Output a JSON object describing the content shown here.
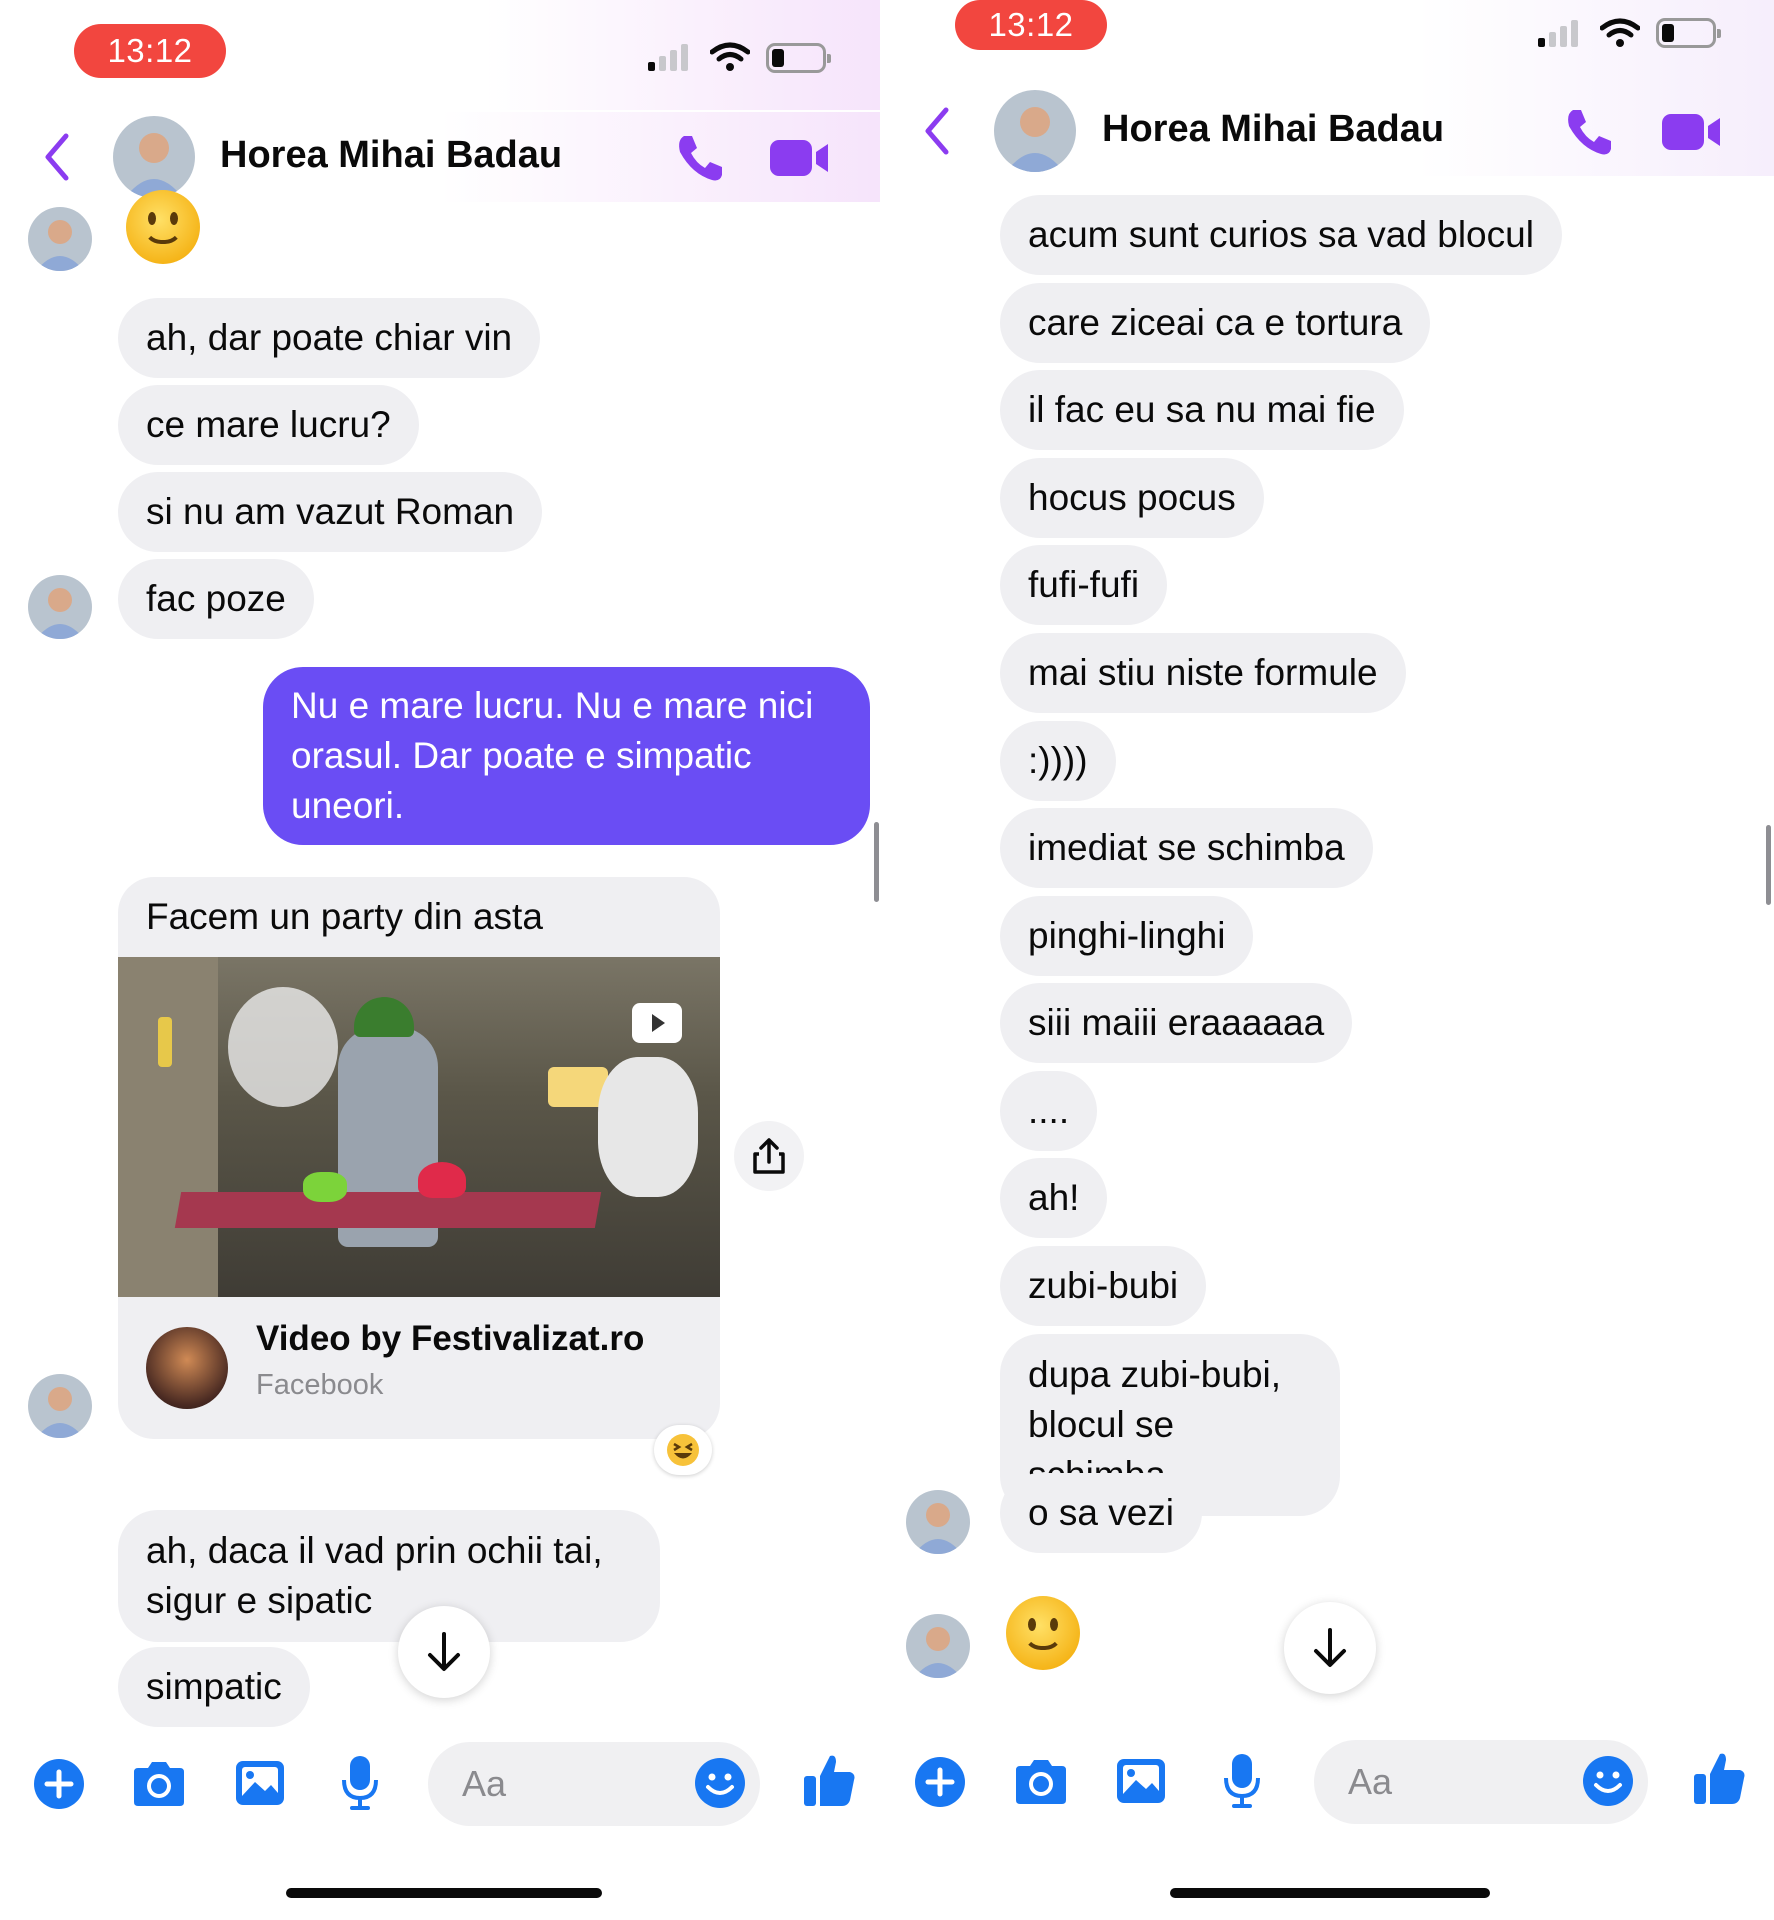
{
  "left": {
    "status": {
      "time": "13:12"
    },
    "header": {
      "contact_name": "Horea Mihai Badau"
    },
    "messages": {
      "m1": "ah, dar poate chiar vin",
      "m2": "ce mare lucru?",
      "m3": "si nu am vazut Roman",
      "m4": "fac poze",
      "mine1": "Nu e mare lucru. Nu e mare nici orasul. Dar poate e simpatic uneori.",
      "card_text": "Facem un party din asta",
      "card_source_title": "Video by Festivalizat.ro",
      "card_source_sub": "Facebook",
      "m5": "ah, daca il vad prin ochii tai, sigur e sipatic",
      "m6": "simpatic"
    },
    "composer": {
      "placeholder": "Aa"
    }
  },
  "right": {
    "status": {
      "time": "13:12"
    },
    "header": {
      "contact_name": "Horea Mihai Badau"
    },
    "messages": [
      "acum sunt curios sa vad blocul",
      "care ziceai ca e tortura",
      "il fac eu sa nu mai fie",
      "hocus pocus",
      "fufi-fufi",
      "mai stiu niste formule",
      ":))))",
      "imediat se schimba",
      "pinghi-linghi",
      "siii maiii eraaaaaa",
      "....",
      "ah!",
      "zubi-bubi",
      "dupa zubi-bubi, blocul se schimba",
      "o sa vezi"
    ],
    "composer": {
      "placeholder": "Aa"
    }
  },
  "colors": {
    "accent": "#8b3cf0",
    "my_bubble": "#6a4df4",
    "their_bubble": "#efeff2",
    "icon_blue": "#1877f2",
    "time_pill": "#f2463f"
  },
  "icons": [
    "back-chevron-icon",
    "phone-icon",
    "video-camera-icon",
    "share-icon",
    "play-icon",
    "arrow-down-icon",
    "plus-icon",
    "camera-icon",
    "gallery-icon",
    "microphone-icon",
    "emoji-icon",
    "thumbs-up-icon"
  ]
}
